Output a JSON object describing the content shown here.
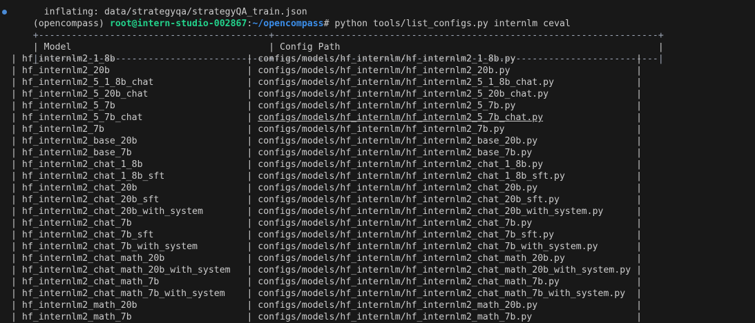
{
  "terminal": {
    "previous_output": "  inflating: data/strategyqa/strategyQA_train.json",
    "prompt": {
      "env": "(opencompass) ",
      "user_host": "root@intern-studio-002867",
      "colon": ":",
      "cwd": "~/opencompass",
      "symbol": "# ",
      "command": "python tools/list_configs.py internlm ceval"
    },
    "table": {
      "border_top": "+------------------------------------------+----------------------------------------------------------------------+",
      "border_mid": "|------------------------------------------+----------------------------------------------------------------------|",
      "headers": {
        "model": "| Model                                    ",
        "config_path": "| Config Path                                                          |"
      },
      "rows": [
        {
          "model": "| hf_internlm2_1_8b                        ",
          "config": "| configs/models/hf_internlm/hf_internlm2_1_8b.py                      |"
        },
        {
          "model": "| hf_internlm2_20b                         ",
          "config": "| configs/models/hf_internlm/hf_internlm2_20b.py                       |"
        },
        {
          "model": "| hf_internlm2_5_1_8b_chat                 ",
          "config": "| configs/models/hf_internlm/hf_internlm2_5_1_8b_chat.py               |"
        },
        {
          "model": "| hf_internlm2_5_20b_chat                  ",
          "config": "| configs/models/hf_internlm/hf_internlm2_5_20b_chat.py                |"
        },
        {
          "model": "| hf_internlm2_5_7b                        ",
          "config": "| configs/models/hf_internlm/hf_internlm2_5_7b.py                      |"
        },
        {
          "model": "| hf_internlm2_5_7b_chat                   ",
          "config_pre": "| ",
          "config_link": "configs/models/hf_internlm/hf_internlm2_5_7b_chat.py",
          "config_post": "                 |"
        },
        {
          "model": "| hf_internlm2_7b                          ",
          "config": "| configs/models/hf_internlm/hf_internlm2_7b.py                        |"
        },
        {
          "model": "| hf_internlm2_base_20b                    ",
          "config": "| configs/models/hf_internlm/hf_internlm2_base_20b.py                  |"
        },
        {
          "model": "| hf_internlm2_base_7b                     ",
          "config": "| configs/models/hf_internlm/hf_internlm2_base_7b.py                   |"
        },
        {
          "model": "| hf_internlm2_chat_1_8b                   ",
          "config": "| configs/models/hf_internlm/hf_internlm2_chat_1_8b.py                 |"
        },
        {
          "model": "| hf_internlm2_chat_1_8b_sft               ",
          "config": "| configs/models/hf_internlm/hf_internlm2_chat_1_8b_sft.py             |"
        },
        {
          "model": "| hf_internlm2_chat_20b                    ",
          "config": "| configs/models/hf_internlm/hf_internlm2_chat_20b.py                  |"
        },
        {
          "model": "| hf_internlm2_chat_20b_sft                ",
          "config": "| configs/models/hf_internlm/hf_internlm2_chat_20b_sft.py              |"
        },
        {
          "model": "| hf_internlm2_chat_20b_with_system        ",
          "config": "| configs/models/hf_internlm/hf_internlm2_chat_20b_with_system.py      |"
        },
        {
          "model": "| hf_internlm2_chat_7b                     ",
          "config": "| configs/models/hf_internlm/hf_internlm2_chat_7b.py                   |"
        },
        {
          "model": "| hf_internlm2_chat_7b_sft                 ",
          "config": "| configs/models/hf_internlm/hf_internlm2_chat_7b_sft.py               |"
        },
        {
          "model": "| hf_internlm2_chat_7b_with_system         ",
          "config": "| configs/models/hf_internlm/hf_internlm2_chat_7b_with_system.py       |"
        },
        {
          "model": "| hf_internlm2_chat_math_20b               ",
          "config": "| configs/models/hf_internlm/hf_internlm2_chat_math_20b.py             |"
        },
        {
          "model": "| hf_internlm2_chat_math_20b_with_system   ",
          "config": "| configs/models/hf_internlm/hf_internlm2_chat_math_20b_with_system.py |"
        },
        {
          "model": "| hf_internlm2_chat_math_7b                ",
          "config": "| configs/models/hf_internlm/hf_internlm2_chat_math_7b.py              |"
        },
        {
          "model": "| hf_internlm2_chat_math_7b_with_system    ",
          "config": "| configs/models/hf_internlm/hf_internlm2_chat_math_7b_with_system.py  |"
        },
        {
          "model": "| hf_internlm2_math_20b                    ",
          "config": "| configs/models/hf_internlm/hf_internlm2_math_20b.py                  |"
        },
        {
          "model": "| hf_internlm2_math_7b                     ",
          "config": "| configs/models/hf_internlm/hf_internlm2_math_7b.py                   |"
        }
      ]
    },
    "colors": {
      "background": "#181818",
      "text": "#cccccc",
      "user_host": "#23d18b",
      "cwd": "#3b8eea",
      "prompt_dot": "#4a8ad4"
    }
  }
}
